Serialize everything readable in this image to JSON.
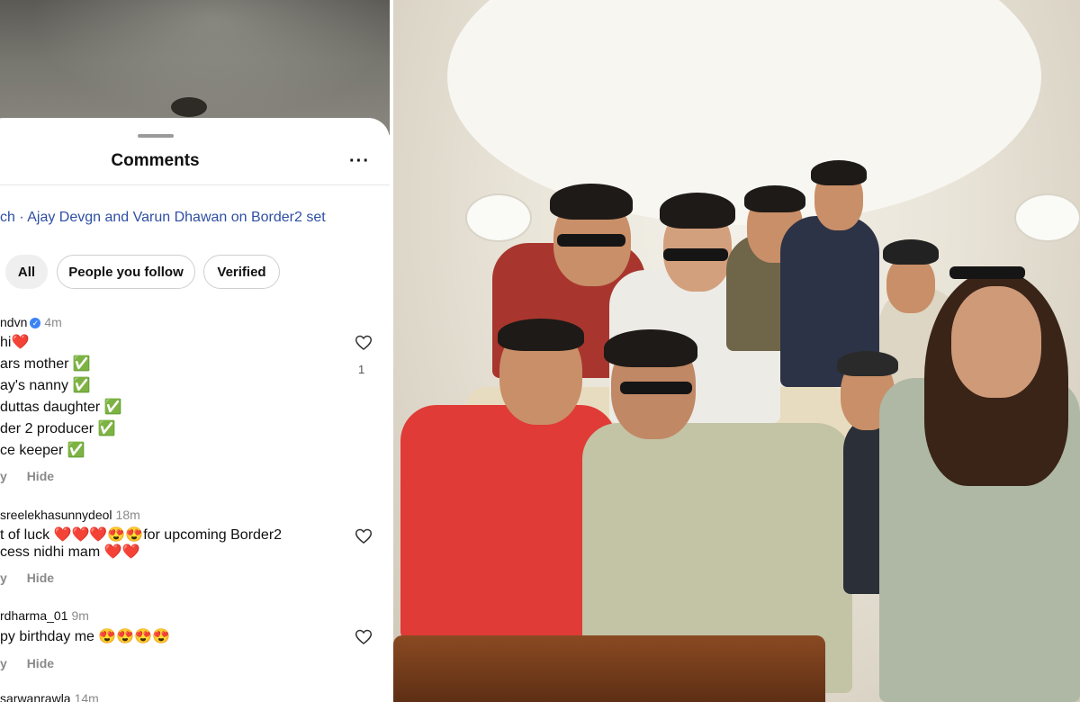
{
  "panel": {
    "title": "Comments",
    "more_label": "···",
    "post_link": "ch · Ajay Devgn and Varun Dhawan on Border2 set"
  },
  "filters": [
    {
      "label": "All",
      "selected": true
    },
    {
      "label": "People you follow",
      "selected": false
    },
    {
      "label": "Verified",
      "selected": false
    }
  ],
  "comments": [
    {
      "username": "ndvn",
      "verified": true,
      "time": "4m",
      "lines": [
        "hi❤️",
        "ars mother ✅",
        "ay's nanny ✅",
        "duttas daughter ✅",
        "der 2 producer ✅",
        "ce keeper ✅"
      ],
      "reply": "y",
      "hide": "Hide",
      "likes": "1"
    },
    {
      "username": "sreelekhasunnydeol",
      "verified": false,
      "time": "18m",
      "lines": [
        "t of luck ❤️❤️❤️😍😍for upcoming Border2",
        "cess nidhi mam ❤️❤️"
      ],
      "reply": "y",
      "hide": "Hide",
      "likes": ""
    },
    {
      "username": "rdharma_01",
      "verified": false,
      "time": "9m",
      "lines": [
        "py birthday me 😍😍😍😍"
      ],
      "reply": "y",
      "hide": "Hide",
      "likes": ""
    },
    {
      "username": "sarwanrawla",
      "verified": false,
      "time": "14m",
      "lines": [],
      "reply": "",
      "hide": "",
      "likes": ""
    }
  ],
  "icons": {
    "heart": "heart-outline-icon",
    "verified": "verified-badge-icon",
    "more": "more-options-icon"
  },
  "colors": {
    "link": "#2e4fa3",
    "verified": "#3b82f6",
    "muted": "#8a8a8a"
  }
}
